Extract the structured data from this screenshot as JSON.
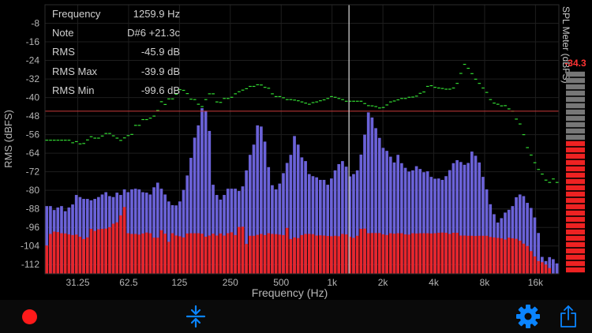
{
  "readout": {
    "rows": [
      {
        "label": "Frequency",
        "value": "1259.9 Hz"
      },
      {
        "label": "Note",
        "value": "D#6 +21.3c"
      },
      {
        "label": "RMS",
        "value": "-45.9 dB"
      },
      {
        "label": "RMS Max",
        "value": "-39.9 dB"
      },
      {
        "label": "RMS Min",
        "value": "-99.6 dB"
      }
    ]
  },
  "chart_data": {
    "type": "bar",
    "xlabel": "Frequency (Hz)",
    "ylabel": "RMS (dBFS)",
    "x_scale": "log",
    "xlim": [
      20,
      22000
    ],
    "ylim": [
      -116,
      0
    ],
    "x_ticks": [
      "31.25",
      "62.5",
      "125",
      "250",
      "500",
      "1k",
      "2k",
      "4k",
      "8k",
      "16k"
    ],
    "y_ticks": [
      "-8",
      "-16",
      "-24",
      "-32",
      "-40",
      "-48",
      "-56",
      "-64",
      "-72",
      "-80",
      "-88",
      "-96",
      "-104",
      "-112"
    ],
    "cursor_frequency_hz": 1259.9,
    "threshold_db": -45.9,
    "colors": {
      "rms_bars": "#6b62d8",
      "min_bars": "#e8262b",
      "peak_marks": "#33dd33",
      "threshold_line": "#c83a3a",
      "cursor_line": "#dddddd"
    },
    "series": [
      {
        "name": "RMS",
        "values": [
          -86.8,
          -86.8,
          -88.5,
          -87.4,
          -86.8,
          -89,
          -87.4,
          -86.1,
          -82,
          -82.9,
          -83.7,
          -83.7,
          -84.3,
          -83.7,
          -82.9,
          -81.8,
          -80.8,
          -82.5,
          -82.9,
          -81,
          -82,
          -79.6,
          -80.8,
          -79.6,
          -79.3,
          -79.6,
          -80.8,
          -81,
          -81.8,
          -78.7,
          -76.7,
          -79.3,
          -81.8,
          -84.8,
          -86.4,
          -86.5,
          -84.8,
          -79.8,
          -73.6,
          -66,
          -57.3,
          -52,
          -44.6,
          -45.7,
          -54.4,
          -77.6,
          -82,
          -84,
          -82,
          -79.3,
          -79.3,
          -79.3,
          -80.3,
          -78.3,
          -71.4,
          -64.7,
          -60.3,
          -52,
          -52.5,
          -59,
          -70,
          -77.8,
          -79.6,
          -77.1,
          -72.6,
          -68.2,
          -64.7,
          -56.6,
          -60.3,
          -65.8,
          -67.4,
          -73,
          -73.9,
          -74.4,
          -75.5,
          -75.5,
          -77.6,
          -74.9,
          -71.4,
          -68.7,
          -67.4,
          -69.8,
          -74,
          -73,
          -71.4,
          -64.6,
          -56,
          -46.4,
          -48.6,
          -53.2,
          -57.4,
          -61.7,
          -63,
          -65.5,
          -68,
          -64.7,
          -68.3,
          -70.3,
          -71.9,
          -71.4,
          -69.6,
          -70.8,
          -72.2,
          -71.8,
          -74.2,
          -75,
          -74.9,
          -75.5,
          -73.9,
          -71.3,
          -68.3,
          -67,
          -67.8,
          -69,
          -68.2,
          -63.3,
          -65.1,
          -68,
          -74.2,
          -79.6,
          -86,
          -90.3,
          -93.9,
          -92,
          -89.6,
          -88.4,
          -86.8,
          -83,
          -81.8,
          -82.5,
          -85.4,
          -87.6,
          -91.7,
          -98.4,
          -108.7,
          -110.5,
          -108.8,
          -109.7,
          -111.5
        ]
      },
      {
        "name": "Min",
        "values": [
          -103.8,
          -98.8,
          -97.8,
          -98,
          -98.5,
          -98.6,
          -99,
          -99.3,
          -99.1,
          -100,
          -101,
          -100.3,
          -96.6,
          -97.5,
          -96.8,
          -96.6,
          -96.5,
          -95.9,
          -94.4,
          -93.8,
          -90.8,
          -87.2,
          -98.5,
          -98.8,
          -98.8,
          -99.1,
          -98.6,
          -98.2,
          -98.5,
          -100.4,
          -100.4,
          -97.2,
          -98.7,
          -102.2,
          -98.5,
          -99.5,
          -99.8,
          -100.3,
          -98.6,
          -98.5,
          -98.5,
          -98.5,
          -98.7,
          -100,
          -99.5,
          -98.7,
          -99.5,
          -98.6,
          -99.5,
          -98.5,
          -98.1,
          -99.3,
          -95.8,
          -95.7,
          -103.1,
          -99.6,
          -99.6,
          -99.2,
          -98.8,
          -99.3,
          -98.5,
          -98.8,
          -98.9,
          -99.1,
          -99.3,
          -96.2,
          -101,
          -100.3,
          -100.6,
          -99.3,
          -98.8,
          -98.8,
          -98.9,
          -99.5,
          -99.4,
          -99.5,
          -99.7,
          -99.8,
          -99.6,
          -99.8,
          -98.8,
          -99,
          -100,
          -100.5,
          -99.6,
          -96.6,
          -96.5,
          -98.5,
          -98.4,
          -98.4,
          -98.4,
          -99,
          -99.3,
          -98.5,
          -98.7,
          -98.5,
          -98.5,
          -99,
          -99.1,
          -98.5,
          -98.6,
          -98.5,
          -98.5,
          -98.5,
          -98.6,
          -98.5,
          -98.3,
          -98.2,
          -98.3,
          -98.8,
          -98.3,
          -98.3,
          -99.5,
          -99.5,
          -99.6,
          -99.6,
          -99.7,
          -99.6,
          -99.6,
          -99.6,
          -100.1,
          -100.3,
          -100.5,
          -100.7,
          -101.2,
          -100.4,
          -100.7,
          -100.9,
          -101.7,
          -103,
          -104,
          -106.2,
          -108.5,
          -110.5,
          -111,
          -112,
          -113.5
        ]
      },
      {
        "name": "Max",
        "values": [
          -58.4,
          -58.4,
          -58.4,
          -58.4,
          -58.4,
          -58.4,
          -58.4,
          -59.5,
          -59,
          -60,
          -59.8,
          -58.3,
          -56.9,
          -57.5,
          -57.5,
          -56.6,
          -55.5,
          -55.5,
          -56.5,
          -57.5,
          -58.5,
          -57.4,
          -56.4,
          -55.9,
          -52,
          -52,
          -49.5,
          -49.5,
          -48.9,
          -48,
          -45.6,
          -41.8,
          -43,
          -40.6,
          -40.6,
          -38.6,
          -36.6,
          -36.9,
          -38.3,
          -40.7,
          -40.9,
          -42.9,
          -43.9,
          -40.9,
          -38.4,
          -38.4,
          -41.9,
          -42.1,
          -40.4,
          -40.4,
          -39.9,
          -38.4,
          -37.5,
          -36.8,
          -36.2,
          -35.2,
          -35.2,
          -34.5,
          -34.6,
          -35.6,
          -36,
          -38.4,
          -39.6,
          -39.6,
          -40.1,
          -40.9,
          -40.9,
          -41.1,
          -41.4,
          -41.9,
          -42.4,
          -42.9,
          -42.2,
          -41.9,
          -41.4,
          -41,
          -40.4,
          -39.6,
          -39.9,
          -40.4,
          -40.9,
          -41.6,
          -41.6,
          -41.6,
          -41.6,
          -41.6,
          -42.6,
          -43.5,
          -43.6,
          -43.9,
          -44.5,
          -44.3,
          -43.2,
          -41.9,
          -41.5,
          -41,
          -40.4,
          -40.4,
          -39.9,
          -39.8,
          -39.4,
          -38.2,
          -37.6,
          -35.2,
          -34.9,
          -35.6,
          -35.9,
          -36.1,
          -36.4,
          -36.4,
          -35.9,
          -33.9,
          -29.6,
          -25.7,
          -27.4,
          -29.7,
          -32.1,
          -33.9,
          -35.9,
          -37.8,
          -40.9,
          -42.4,
          -42.9,
          -43.6,
          -43.5,
          -44.9,
          -45.9,
          -49.3,
          -51.4,
          -56,
          -61.6,
          -64.8,
          -68.1,
          -71,
          -73,
          -75.6,
          -76.6,
          -75.1,
          -76.6,
          -78
        ]
      }
    ]
  },
  "spl_meter": {
    "title": "SPL Meter (dBFS)",
    "value": "-34.3",
    "level_db": -34.3,
    "min_db": -96,
    "max_db": 0,
    "segments": 32,
    "colors": {
      "lit": "#ee2222",
      "unlit": "#777777"
    }
  },
  "toolbar": {
    "colors": {
      "record": "#ff1a1a",
      "icons": "#0a84ff"
    },
    "icons": [
      "record-icon",
      "compress-icon",
      "gear-icon",
      "share-icon"
    ]
  }
}
